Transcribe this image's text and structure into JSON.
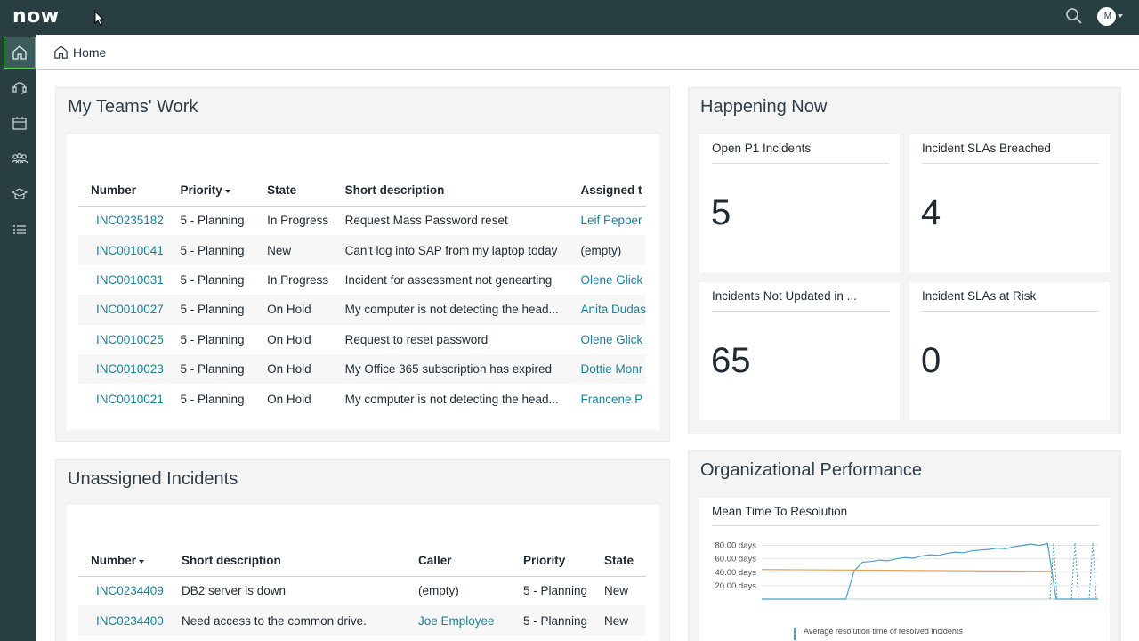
{
  "app": {
    "logo": "now",
    "avatar_initials": "IM"
  },
  "breadcrumb": {
    "label": "Home"
  },
  "teams_work": {
    "title": "My Teams' Work",
    "headers": [
      "Number",
      "Priority",
      "State",
      "Short description",
      "Assigned t"
    ],
    "rows": [
      [
        "INC0235182",
        "5 - Planning",
        "In Progress",
        "Request Mass Password reset",
        "Leif Pepper"
      ],
      [
        "INC0010041",
        "5 - Planning",
        "New",
        "Can't log into SAP from my laptop today",
        "(empty)"
      ],
      [
        "INC0010031",
        "5 - Planning",
        "In Progress",
        "Incident for assessment not genearting",
        "Olene Glick"
      ],
      [
        "INC0010027",
        "5 - Planning",
        "On Hold",
        "My computer is not detecting the head...",
        "Anita Dudas"
      ],
      [
        "INC0010025",
        "5 - Planning",
        "On Hold",
        "Request to reset password",
        "Olene Glick"
      ],
      [
        "INC0010023",
        "5 - Planning",
        "On Hold",
        "My Office 365 subscription has expired",
        "Dottie Monr"
      ],
      [
        "INC0010021",
        "5 - Planning",
        "On Hold",
        "My computer is not detecting the head...",
        "Francene P"
      ]
    ]
  },
  "unassigned": {
    "title": "Unassigned Incidents",
    "headers": [
      "Number",
      "Short description",
      "Caller",
      "Priority",
      "State"
    ],
    "rows": [
      [
        "INC0234409",
        "DB2 server is down",
        "(empty)",
        "5 - Planning",
        "New"
      ],
      [
        "INC0234400",
        "Need access to the common drive.",
        "Joe Employee",
        "5 - Planning",
        "New"
      ]
    ]
  },
  "happening_now": {
    "title": "Happening Now",
    "tiles": [
      {
        "label": "Open P1 Incidents",
        "value": "5"
      },
      {
        "label": "Incident SLAs Breached",
        "value": "4"
      },
      {
        "label": "Incidents Not Updated in ...",
        "value": "65"
      },
      {
        "label": "Incident SLAs at Risk",
        "value": "0"
      }
    ]
  },
  "org_performance": {
    "title": "Organizational Performance",
    "chart_title": "Mean Time To Resolution",
    "legend": "Average resolution time of resolved incidents",
    "line_color": "#4a9fc8",
    "avg_color": "#e0a35a"
  },
  "chart_data": {
    "type": "line",
    "title": "Mean Time To Resolution",
    "y_ticks": [
      "80.00 days",
      "60.00 days",
      "40.00 days",
      "20.00 days"
    ],
    "ylim": [
      0,
      90
    ],
    "series": [
      {
        "name": "Average resolution time of resolved incidents",
        "x": [
          0,
          1,
          2,
          3,
          4,
          5,
          6,
          7,
          8,
          9,
          10,
          11,
          12,
          13,
          14,
          15,
          16,
          17,
          18,
          19,
          20,
          21,
          22,
          23,
          24,
          25,
          26,
          27,
          28,
          29,
          30,
          31,
          32,
          33,
          34,
          35,
          36,
          37,
          38,
          39,
          40
        ],
        "values": [
          0,
          0,
          0,
          0,
          0,
          0,
          0,
          0,
          0,
          0,
          0,
          42,
          55,
          56,
          58,
          57,
          60,
          62,
          61,
          64,
          66,
          65,
          68,
          70,
          69,
          72,
          73,
          74,
          76,
          75,
          78,
          80,
          82,
          80,
          83,
          0,
          0,
          0,
          0,
          0,
          0
        ]
      }
    ],
    "average": 44,
    "grid": true
  },
  "rail_icons": [
    "home-icon",
    "headset-icon",
    "calendar-icon",
    "people-icon",
    "graduation-cap-icon",
    "list-icon"
  ]
}
